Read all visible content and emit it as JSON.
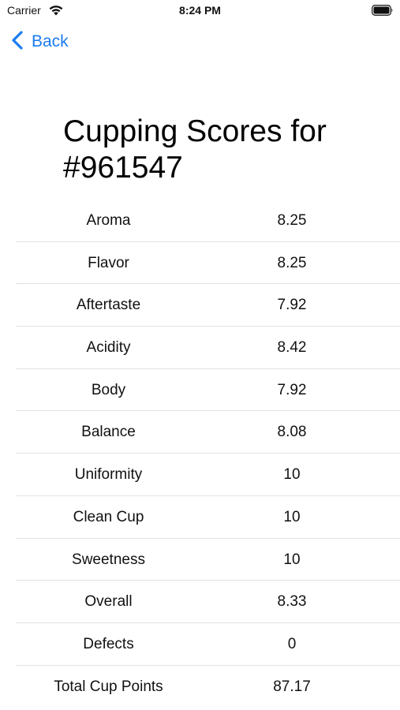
{
  "status_bar": {
    "carrier": "Carrier",
    "time": "8:24 PM",
    "wifi_icon": "wifi-icon",
    "battery_icon": "battery-icon"
  },
  "nav": {
    "back_label": "Back",
    "back_icon": "chevron-left-icon",
    "accent_color": "#1a7cf0"
  },
  "title": "Cupping Scores for #961547",
  "scores": [
    {
      "label": "Aroma",
      "value": "8.25"
    },
    {
      "label": "Flavor",
      "value": "8.25"
    },
    {
      "label": "Aftertaste",
      "value": "7.92"
    },
    {
      "label": "Acidity",
      "value": "8.42"
    },
    {
      "label": "Body",
      "value": "7.92"
    },
    {
      "label": "Balance",
      "value": "8.08"
    },
    {
      "label": "Uniformity",
      "value": "10"
    },
    {
      "label": "Clean Cup",
      "value": "10"
    },
    {
      "label": "Sweetness",
      "value": "10"
    },
    {
      "label": "Overall",
      "value": "8.33"
    },
    {
      "label": "Defects",
      "value": "0"
    },
    {
      "label": "Total Cup Points",
      "value": "87.17"
    }
  ]
}
